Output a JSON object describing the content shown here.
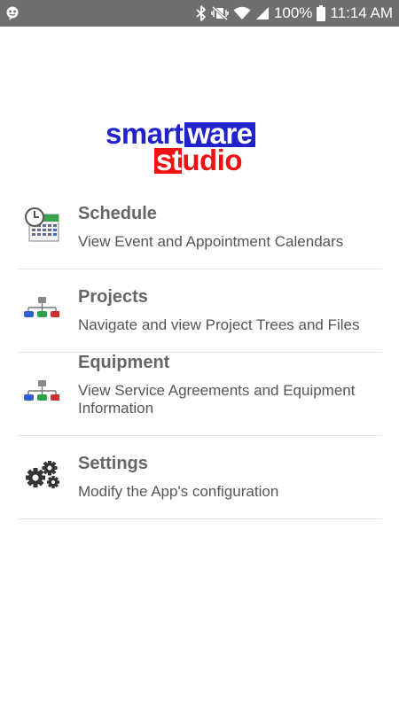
{
  "status_bar": {
    "battery": "100%",
    "time": "11:14 AM",
    "icons": [
      "notification-icon",
      "bluetooth-icon",
      "vibrate-mute-icon",
      "wifi-icon",
      "signal-icon",
      "battery-icon"
    ]
  },
  "logo": {
    "part1": "smart",
    "part2": "ware",
    "part3": "st",
    "part4": "udio",
    "colors": {
      "blue": "#2222cc",
      "red": "#ee1111"
    }
  },
  "menu": {
    "items": [
      {
        "title": "Schedule",
        "description": "View Event and Appointment Calendars",
        "icon": "calendar-clock-icon"
      },
      {
        "title": "Projects",
        "description": "Navigate and view Project Trees and Files",
        "icon": "hierarchy-tree-icon"
      },
      {
        "title": "Equipment",
        "description": "View Service Agreements and Equipment Information",
        "icon": "hierarchy-tree-icon"
      },
      {
        "title": "Settings",
        "description": "Modify the App's configuration",
        "icon": "gears-icon"
      }
    ]
  }
}
